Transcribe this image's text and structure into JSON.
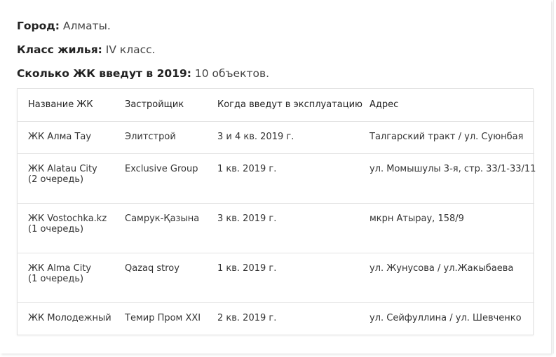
{
  "info": {
    "city_label": "Город:",
    "city_value": " Алматы.",
    "class_label": "Класс жилья:",
    "class_value": " IV класс.",
    "count_label": "Сколько ЖК введут в 2019:",
    "count_value": " 10 объектов."
  },
  "table": {
    "headers": [
      "Название ЖК",
      "Застройщик",
      "Когда введут в эксплуатацию",
      "Адрес"
    ],
    "rows": [
      {
        "name": "ЖК Алма Тау",
        "name_sub": "",
        "developer": "Элитстрой",
        "date": "3 и 4 кв. 2019 г.",
        "address": "Талгарский тракт / ул. Суюнбая"
      },
      {
        "name": "ЖК Alatau City",
        "name_sub": "(2 очередь)",
        "developer": "Exclusive Group",
        "date": "1 кв. 2019 г.",
        "address": "ул. Момышулы 3-я, стр. 33/1-33/11"
      },
      {
        "name": "ЖК Vostochka.kz",
        "name_sub": "(1 очередь)",
        "developer": "Самрук-Қазына",
        "date": "3 кв. 2019 г.",
        "address": "мкрн Атырау, 158/9"
      },
      {
        "name": "ЖК Alma City",
        "name_sub": "(1 очередь)",
        "developer": "Qazaq stroy",
        "date": "1 кв. 2019 г.",
        "address": "ул. Жунусова / ул.Жакыбаева"
      },
      {
        "name": "ЖК Молодежный",
        "name_sub": "",
        "developer": "Темир Пром XXI",
        "date": "2 кв. 2019 г.",
        "address": "ул. Сейфуллина / ул. Шевченко"
      }
    ]
  }
}
